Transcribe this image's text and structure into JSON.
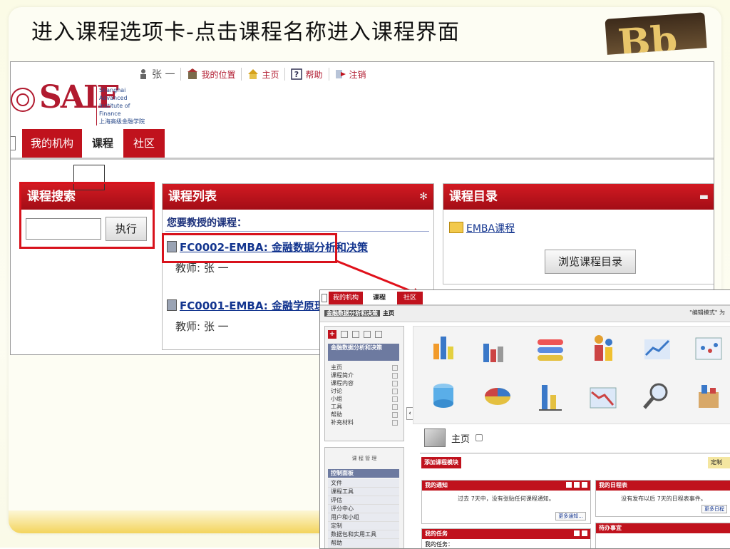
{
  "slide": {
    "title": "进入课程选项卡-点击课程名称进入课程界面",
    "logo_text": "Bb"
  },
  "portal": {
    "brand": {
      "name": "SAIF",
      "sub_line1": "Shanghai Advanced",
      "sub_line2": "Institute of Finance",
      "sub_line3": "上海高级金融学院"
    },
    "topnav": {
      "user": "张 一",
      "my_location": "我的位置",
      "home": "主页",
      "help": "帮助",
      "logout": "注销"
    },
    "tabs": [
      "我的机构",
      "课程",
      "社区"
    ],
    "search": {
      "title": "课程搜索",
      "input_value": "",
      "button": "执行"
    },
    "course_list": {
      "title": "课程列表",
      "subtitle": "您要教授的课程：",
      "courses": [
        {
          "name": "FC0002-EMBA: 金融数据分析和决策",
          "teacher": "教师: 张 一"
        },
        {
          "name": "FC0001-EMBA: 金融学原理",
          "teacher": "教师: 张 一"
        }
      ]
    },
    "catalog": {
      "title": "课程目录",
      "folder": "EMBA课程",
      "button": "浏览课程目录"
    }
  },
  "course_page": {
    "tabs": [
      "我的机构",
      "课程",
      "社区"
    ],
    "breadcrumb_course": "金融数据分析和决策",
    "breadcrumb_home": "主页",
    "edit_mode": "\"编辑模式\" 为",
    "side_title": "金融数据分析和决策",
    "menu": [
      "主页",
      "课程简介",
      "课程内容",
      "讨论",
      "小组",
      "工具",
      "帮助",
      "补充材料"
    ],
    "mgmt_title": "课 程 管 理",
    "control_panel": "控制面板",
    "cp_items": [
      "文件",
      "课程工具",
      "评估",
      "评分中心",
      "用户和小组",
      "定制",
      "数据包和实用工具",
      "帮助"
    ],
    "home_title": "主页",
    "add_module": "添加课程模块",
    "customize": "定制",
    "modules": {
      "notices": {
        "title": "我的通知",
        "body": "过去 7天中，没有张贴任何课程通知。",
        "more": "更多通知..."
      },
      "calendar": {
        "title": "我的日程表",
        "body": "没有发布以后 7天的日程表事件。",
        "more": "更多日程"
      },
      "tasks": {
        "title": "我的任务",
        "body": "我的任务："
      },
      "todo": {
        "title": "待办事宜"
      }
    }
  }
}
